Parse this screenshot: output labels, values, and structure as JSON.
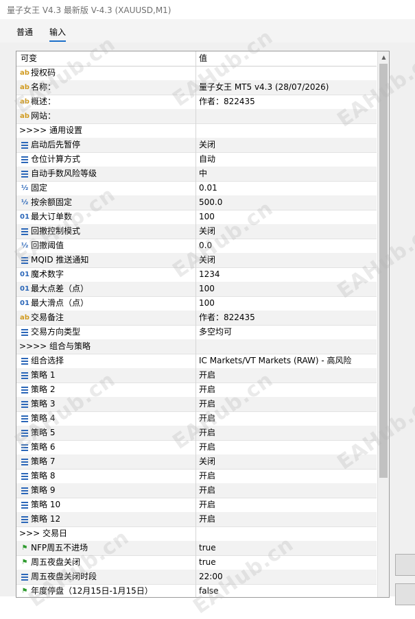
{
  "window": {
    "title": "量子女王 V4.3 最新版 V-4.3 (XAUUSD,M1)"
  },
  "tabs": [
    {
      "label": "普通"
    },
    {
      "label": "输入"
    }
  ],
  "table": {
    "columns": [
      "可变",
      "值"
    ],
    "rows": [
      {
        "icon": "ab",
        "name": "授权码",
        "value": ""
      },
      {
        "icon": "ab",
        "name": "名称：",
        "value": "量子女王 MT5 v4.3 (28/07/2026)"
      },
      {
        "icon": "ab",
        "name": "概述：",
        "value": "作者：822435"
      },
      {
        "icon": "ab",
        "name": "网站：",
        "value": ""
      },
      {
        "icon": "",
        "name": ">>>> 通用设置",
        "value": ""
      },
      {
        "icon": "list",
        "name": "启动后先暂停",
        "value": "关闭"
      },
      {
        "icon": "list",
        "name": "仓位计算方式",
        "value": "自动"
      },
      {
        "icon": "list",
        "name": "自动手数风险等级",
        "value": "中"
      },
      {
        "icon": "half",
        "name": "固定",
        "value": "0.01"
      },
      {
        "icon": "half",
        "name": "按余额固定",
        "value": "500.0"
      },
      {
        "icon": "01",
        "name": "最大订单数",
        "value": "100"
      },
      {
        "icon": "list",
        "name": "回撤控制模式",
        "value": "关闭"
      },
      {
        "icon": "half",
        "name": "回撤阈值",
        "value": "0.0"
      },
      {
        "icon": "list",
        "name": "MQID 推送通知",
        "value": "关闭"
      },
      {
        "icon": "01",
        "name": "魔术数字",
        "value": "1234"
      },
      {
        "icon": "01",
        "name": "最大点差（点）",
        "value": "100"
      },
      {
        "icon": "01",
        "name": "最大滑点（点）",
        "value": "100"
      },
      {
        "icon": "ab",
        "name": "交易备注",
        "value": "作者：822435"
      },
      {
        "icon": "list",
        "name": "交易方向类型",
        "value": "多空均可"
      },
      {
        "icon": "",
        "name": ">>>> 组合与策略",
        "value": ""
      },
      {
        "icon": "list",
        "name": "组合选择",
        "value": "IC Markets/VT Markets (RAW) - 高风险"
      },
      {
        "icon": "list",
        "name": "策略 1",
        "value": "开启"
      },
      {
        "icon": "list",
        "name": "策略 2",
        "value": "开启"
      },
      {
        "icon": "list",
        "name": "策略 3",
        "value": "开启"
      },
      {
        "icon": "list",
        "name": "策略 4",
        "value": "开启"
      },
      {
        "icon": "list",
        "name": "策略 5",
        "value": "开启"
      },
      {
        "icon": "list",
        "name": "策略 6",
        "value": "开启"
      },
      {
        "icon": "list",
        "name": "策略 7",
        "value": "关闭"
      },
      {
        "icon": "list",
        "name": "策略 8",
        "value": "开启"
      },
      {
        "icon": "list",
        "name": "策略 9",
        "value": "开启"
      },
      {
        "icon": "list",
        "name": "策略 10",
        "value": "开启"
      },
      {
        "icon": "list",
        "name": "策略 12",
        "value": "开启"
      },
      {
        "icon": "",
        "name": ">>> 交易日",
        "value": ""
      },
      {
        "icon": "flag",
        "name": "NFP周五不进场",
        "value": "true"
      },
      {
        "icon": "flag",
        "name": "周五夜盘关闭",
        "value": "true"
      },
      {
        "icon": "list",
        "name": "周五夜盘关闭时段",
        "value": "22:00"
      },
      {
        "icon": "flag",
        "name": "年度停盘（12月15日-1月15日）",
        "value": "false"
      }
    ]
  },
  "watermark": {
    "text": "EAHub.cn"
  },
  "colors": {
    "accent": "#1a6fc9",
    "alt_row": "#f2f2f2",
    "icon_blue": "#2a66b8",
    "icon_ab": "#d09a1f",
    "icon_flag": "#2e9a2e"
  }
}
